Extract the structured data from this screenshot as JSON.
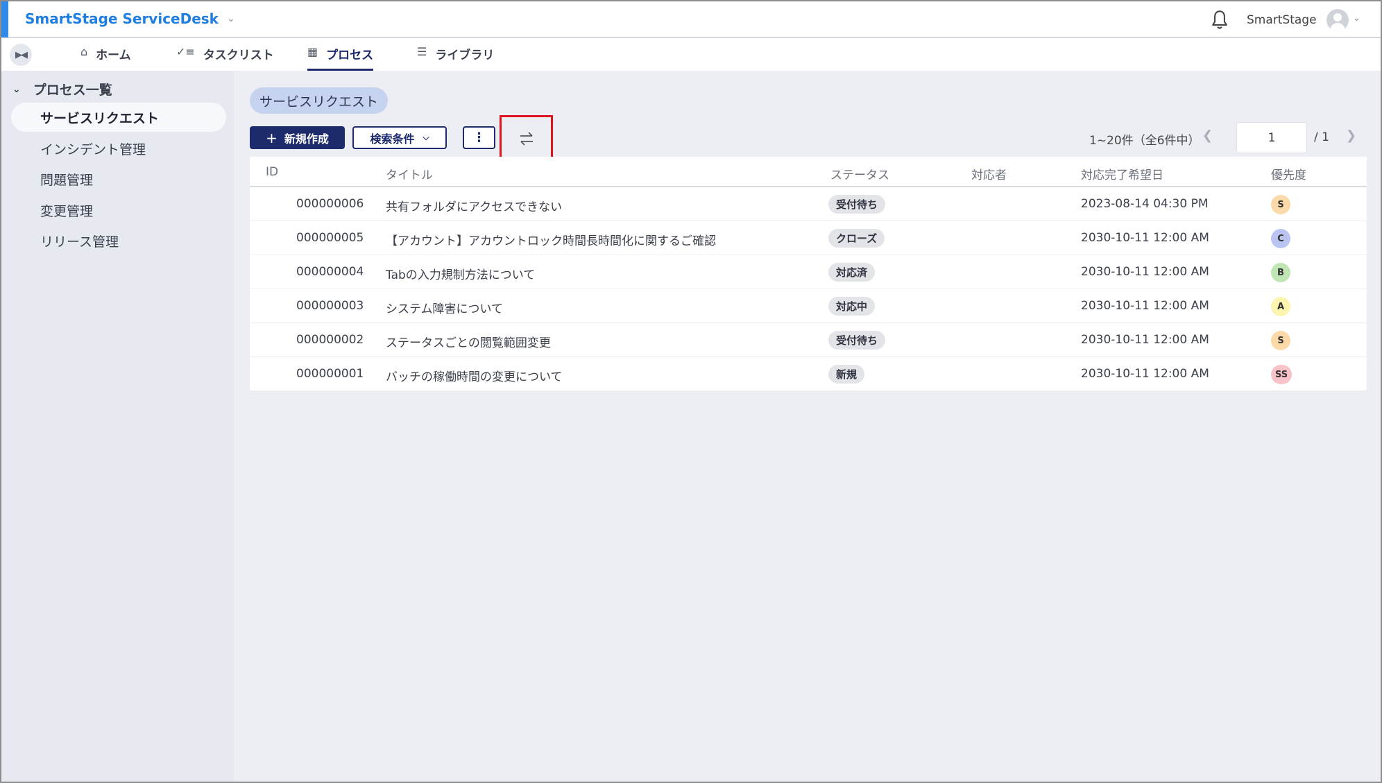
{
  "header": {
    "app_title": "SmartStage ServiceDesk",
    "user_name": "SmartStage"
  },
  "nav": {
    "tabs": [
      {
        "label": "ホーム",
        "icon": "home-icon"
      },
      {
        "label": "タスクリスト",
        "icon": "checklist-icon"
      },
      {
        "label": "プロセス",
        "icon": "building-icon",
        "active": true
      },
      {
        "label": "ライブラリ",
        "icon": "list-icon"
      }
    ]
  },
  "sidebar": {
    "group_label": "プロセス一覧",
    "items": [
      {
        "label": "サービスリクエスト",
        "active": true
      },
      {
        "label": "インシデント管理"
      },
      {
        "label": "問題管理"
      },
      {
        "label": "変更管理"
      },
      {
        "label": "リリース管理"
      }
    ]
  },
  "main": {
    "chip_label": "サービスリクエスト",
    "new_button_label": "新規作成",
    "search_button_label": "検索条件",
    "paging": {
      "range_text": "1~20件（全6件中）",
      "page": "1",
      "total_text": "/ 1"
    },
    "table": {
      "headers": [
        "ID",
        "タイトル",
        "ステータス",
        "対応者",
        "対応完了希望日",
        "優先度"
      ],
      "rows": [
        {
          "id": "000000006",
          "title": "共有フォルダにアクセスできない",
          "status": "受付待ち",
          "assignee": "",
          "due": "2023-08-14 04:30 PM",
          "priority": "S"
        },
        {
          "id": "000000005",
          "title": "【アカウント】アカウントロック時間長時間化に関するご確認",
          "status": "クローズ",
          "assignee": "",
          "due": "2030-10-11 12:00 AM",
          "priority": "C"
        },
        {
          "id": "000000004",
          "title": "Tabの入力規制方法について",
          "status": "対応済",
          "assignee": "",
          "due": "2030-10-11 12:00 AM",
          "priority": "B"
        },
        {
          "id": "000000003",
          "title": "システム障害について",
          "status": "対応中",
          "assignee": "",
          "due": "2030-10-11 12:00 AM",
          "priority": "A"
        },
        {
          "id": "000000002",
          "title": "ステータスごとの閲覧範囲変更",
          "status": "受付待ち",
          "assignee": "",
          "due": "2030-10-11 12:00 AM",
          "priority": "S"
        },
        {
          "id": "000000001",
          "title": "バッチの稼働時間の変更について",
          "status": "新規",
          "assignee": "",
          "due": "2030-10-11 12:00 AM",
          "priority": "SS"
        }
      ]
    },
    "priority_colors": {
      "S": "#fcd9a8",
      "C": "#b9c4f0",
      "B": "#bfe6b4",
      "A": "#fbf5b0",
      "SS": "#f7c3c8"
    }
  }
}
